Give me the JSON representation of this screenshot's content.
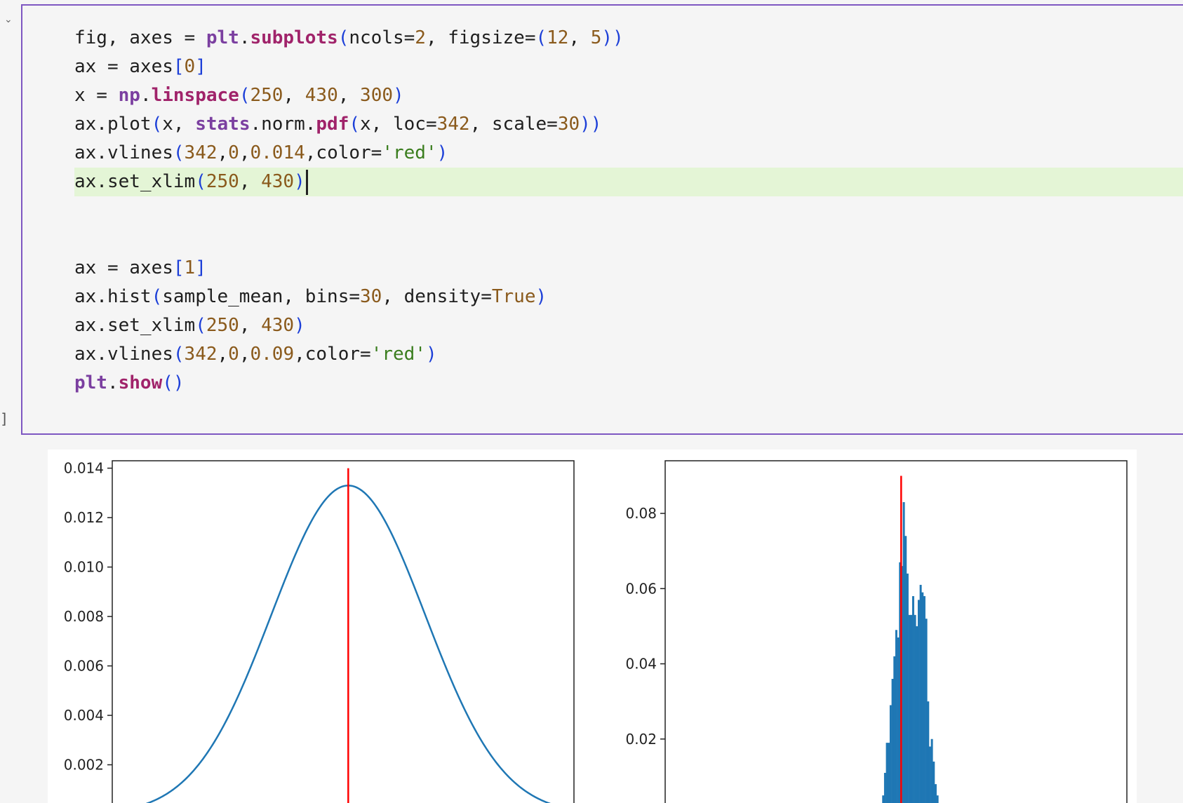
{
  "cell": {
    "prompt_bracket": "]",
    "lines": [
      "fig, axes = plt.subplots(ncols=2, figsize=(12, 5))",
      "ax = axes[0]",
      "x = np.linspace(250, 430, 300)",
      "ax.plot(x, stats.norm.pdf(x, loc=342, scale=30))",
      "ax.vlines(342,0,0.014,color='red')",
      "ax.set_xlim(250, 430)",
      "",
      "",
      "ax = axes[1]",
      "ax.hist(sample_mean, bins=30, density=True)",
      "ax.set_xlim(250, 430)",
      "ax.vlines(342,0,0.09,color='red')",
      "plt.show()"
    ]
  },
  "chart_data": [
    {
      "type": "line",
      "xlim": [
        250,
        430
      ],
      "ylim": [
        0,
        0.0143
      ],
      "yticks": [
        "0.014",
        "0.012",
        "0.010",
        "0.008",
        "0.006",
        "0.004",
        "0.002"
      ],
      "ytick_values": [
        0.014,
        0.012,
        0.01,
        0.008,
        0.006,
        0.004,
        0.002
      ],
      "series": [
        {
          "distribution": "normal",
          "loc": 342,
          "scale": 30,
          "x_range": [
            250,
            430
          ],
          "color": "#1f77b4"
        }
      ],
      "vline": {
        "x": 342,
        "ymin": 0,
        "ymax": 0.014,
        "color": "red"
      },
      "grid": false
    },
    {
      "type": "bar",
      "xlim": [
        250,
        430
      ],
      "ylim": [
        0,
        0.094
      ],
      "yticks": [
        "0.08",
        "0.06",
        "0.04",
        "0.02"
      ],
      "ytick_values": [
        0.08,
        0.06,
        0.04,
        0.02
      ],
      "bins_x_start": 334.6,
      "bin_width": 0.73,
      "values": [
        0.005,
        0.011,
        0.019,
        0.019,
        0.029,
        0.036,
        0.042,
        0.049,
        0.047,
        0.067,
        0.066,
        0.083,
        0.074,
        0.064,
        0.053,
        0.053,
        0.058,
        0.053,
        0.05,
        0.057,
        0.061,
        0.059,
        0.058,
        0.052,
        0.03,
        0.018,
        0.02,
        0.014,
        0.008,
        0.005
      ],
      "bar_color": "#1f77b4",
      "vline": {
        "x": 342,
        "ymin": 0,
        "ymax": 0.09,
        "color": "red"
      },
      "grid": false
    }
  ]
}
